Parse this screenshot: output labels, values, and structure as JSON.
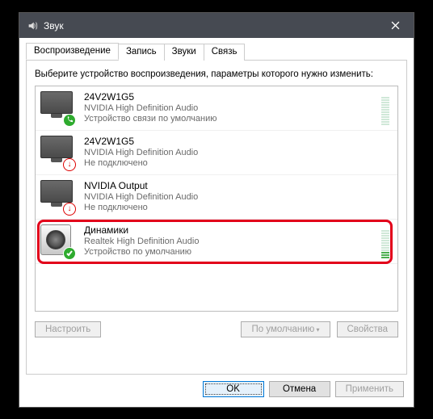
{
  "window": {
    "title": "Звук"
  },
  "tabs": {
    "items": [
      {
        "label": "Воспроизведение",
        "active": true
      },
      {
        "label": "Запись",
        "active": false
      },
      {
        "label": "Звуки",
        "active": false
      },
      {
        "label": "Связь",
        "active": false
      }
    ]
  },
  "prompt": "Выберите устройство воспроизведения, параметры которого нужно изменить:",
  "devices": [
    {
      "name": "24V2W1G5",
      "driver": "NVIDIA High Definition Audio",
      "status": "Устройство связи по умолчанию",
      "icon": "monitor",
      "badge": "phone-green",
      "meter": "idle"
    },
    {
      "name": "24V2W1G5",
      "driver": "NVIDIA High Definition Audio",
      "status": "Не подключено",
      "icon": "monitor",
      "badge": "down-red",
      "meter": "none"
    },
    {
      "name": "NVIDIA Output",
      "driver": "NVIDIA High Definition Audio",
      "status": "Не подключено",
      "icon": "monitor",
      "badge": "down-red",
      "meter": "none"
    },
    {
      "name": "Динамики",
      "driver": "Realtek High Definition Audio",
      "status": "Устройство по умолчанию",
      "icon": "speaker",
      "badge": "check-green",
      "meter": "active"
    }
  ],
  "panelButtons": {
    "configure": "Настроить",
    "setDefault": "По умолчанию",
    "properties": "Свойства"
  },
  "dialogButtons": {
    "ok": "OK",
    "cancel": "Отмена",
    "apply": "Применить"
  }
}
